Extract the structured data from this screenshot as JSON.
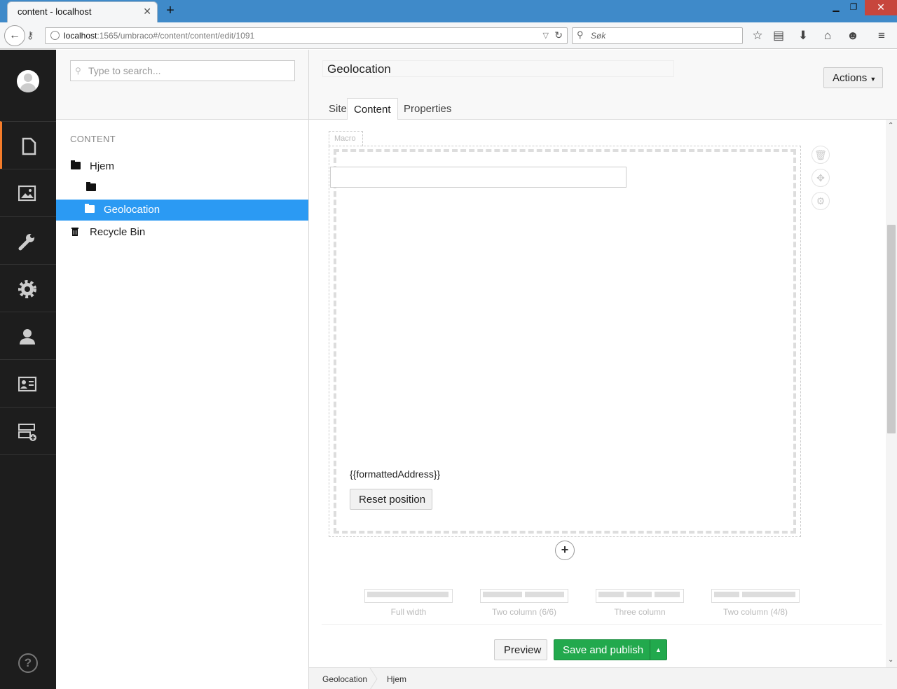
{
  "browser": {
    "tab_title": "content - localhost",
    "url_host": "localhost",
    "url_path": ":1565/umbraco#/content/content/edit/1091",
    "search_placeholder": "Søk"
  },
  "tree": {
    "search_placeholder": "Type to search...",
    "section_title": "CONTENT",
    "items": [
      {
        "label": "Hjem"
      },
      {
        "label": ""
      },
      {
        "label": "Geolocation"
      },
      {
        "label": "Recycle Bin"
      }
    ]
  },
  "editor": {
    "node_name": "Geolocation",
    "actions_label": "Actions",
    "tabs": [
      {
        "label": "Site"
      },
      {
        "label": "Content"
      },
      {
        "label": "Properties"
      }
    ],
    "active_tab": "Content",
    "macro_label": "Macro",
    "formatted_address": "{{formattedAddress}}",
    "reset_label": "Reset position",
    "layouts": [
      {
        "label": "Full width"
      },
      {
        "label": "Two column (6/6)"
      },
      {
        "label": "Three column"
      },
      {
        "label": "Two column (4/8)"
      }
    ],
    "preview_label": "Preview",
    "save_label": "Save and publish"
  },
  "breadcrumb": [
    "Geolocation",
    "Hjem"
  ],
  "colors": {
    "accent": "#2b9af3",
    "save_green": "#22a94d",
    "sidebar_bg": "#1d1d1d",
    "active_section": "#f57c2a"
  }
}
